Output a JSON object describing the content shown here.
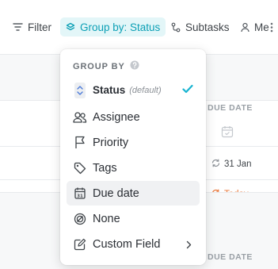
{
  "toolbar": {
    "filter_label": "Filter",
    "group_label": "Group by: Status",
    "subtasks_label": "Subtasks",
    "me_label": "Me"
  },
  "list": {
    "due_date_header": "DUE DATE",
    "row_due_1": "31 Jan",
    "row_due_2": "Today"
  },
  "menu": {
    "title": "GROUP BY",
    "items": [
      {
        "label": "Status",
        "note": "(default)",
        "icon": "status-updown-icon",
        "selected": true
      },
      {
        "label": "Assignee",
        "icon": "people-icon"
      },
      {
        "label": "Priority",
        "icon": "flag-icon"
      },
      {
        "label": "Tags",
        "icon": "tag-icon"
      },
      {
        "label": "Due date",
        "icon": "calendar-icon",
        "hovered": true
      },
      {
        "label": "None",
        "icon": "none-icon"
      },
      {
        "label": "Custom Field",
        "icon": "custom-field-icon",
        "has_submenu": true
      }
    ]
  },
  "colors": {
    "accent": "#0b9fb5",
    "accent_bg": "#e3f6f8",
    "check": "#19b4d1",
    "today": "#e8763a"
  }
}
